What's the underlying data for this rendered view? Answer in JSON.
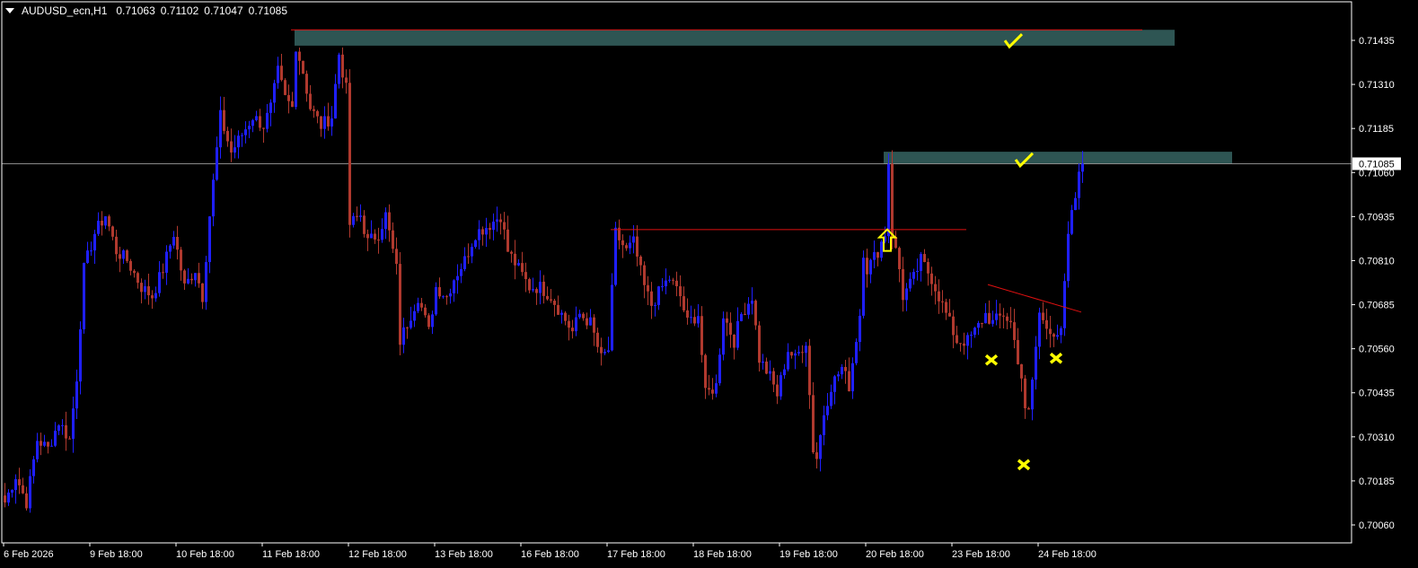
{
  "header": {
    "symbol": "AUDUSD_ecn,H1",
    "open": "0.71063",
    "high": "0.71102",
    "low": "0.71047",
    "close": "0.71085"
  },
  "colors": {
    "bull": "#1f1fff",
    "bear": "#b0392e",
    "zone": "#2e5553",
    "level_line": "#e01010",
    "marker": "#ffff00",
    "axis": "#ffffff",
    "price_line": "#8a8a8a"
  },
  "chart_data": {
    "type": "candlestick",
    "symbol": "AUDUSD_ecn",
    "timeframe": "H1",
    "ylim": [
      0.7001,
      0.7156
    ],
    "xlim": [
      0,
      375
    ],
    "y_ticks": [
      "0.71435",
      "0.71310",
      "0.71185",
      "0.71060",
      "0.70935",
      "0.70810",
      "0.70685",
      "0.70560",
      "0.70435",
      "0.70310",
      "0.70185",
      "0.70060"
    ],
    "x_ticks": [
      {
        "i": 0,
        "label": "6 Feb 2026"
      },
      {
        "i": 24,
        "label": "9 Feb 18:00"
      },
      {
        "i": 48,
        "label": "10 Feb 18:00"
      },
      {
        "i": 72,
        "label": "11 Feb 18:00"
      },
      {
        "i": 96,
        "label": "12 Feb 18:00"
      },
      {
        "i": 120,
        "label": "13 Feb 18:00"
      },
      {
        "i": 144,
        "label": "16 Feb 18:00"
      },
      {
        "i": 168,
        "label": "17 Feb 18:00"
      },
      {
        "i": 192,
        "label": "18 Feb 18:00"
      },
      {
        "i": 216,
        "label": "19 Feb 18:00"
      },
      {
        "i": 240,
        "label": "20 Feb 18:00"
      },
      {
        "i": 264,
        "label": "23 Feb 18:00"
      },
      {
        "i": 288,
        "label": "24 Feb 18:00"
      }
    ],
    "current_price": "0.71085",
    "close_waypoints": [
      [
        0,
        0.70124
      ],
      [
        3,
        0.702
      ],
      [
        6,
        0.70124
      ],
      [
        9,
        0.70302
      ],
      [
        12,
        0.70276
      ],
      [
        15,
        0.70353
      ],
      [
        18,
        0.70302
      ],
      [
        20,
        0.7048
      ],
      [
        22,
        0.70786
      ],
      [
        25,
        0.70888
      ],
      [
        28,
        0.70939
      ],
      [
        31,
        0.70837
      ],
      [
        34,
        0.70811
      ],
      [
        38,
        0.70735
      ],
      [
        41,
        0.70709
      ],
      [
        44,
        0.70786
      ],
      [
        47,
        0.70888
      ],
      [
        50,
        0.70735
      ],
      [
        53,
        0.70786
      ],
      [
        55,
        0.70709
      ],
      [
        57,
        0.70939
      ],
      [
        60,
        0.71219
      ],
      [
        63,
        0.71117
      ],
      [
        66,
        0.71168
      ],
      [
        69,
        0.71219
      ],
      [
        72,
        0.71193
      ],
      [
        74,
        0.71244
      ],
      [
        76,
        0.71346
      ],
      [
        78,
        0.7127
      ],
      [
        80,
        0.71244
      ],
      [
        81,
        0.71422
      ],
      [
        83,
        0.71346
      ],
      [
        85,
        0.71244
      ],
      [
        88,
        0.71193
      ],
      [
        91,
        0.71219
      ],
      [
        93,
        0.71397
      ],
      [
        95,
        0.71295
      ],
      [
        96,
        0.70913
      ],
      [
        99,
        0.70939
      ],
      [
        101,
        0.70862
      ],
      [
        104,
        0.70888
      ],
      [
        106,
        0.70939
      ],
      [
        109,
        0.70786
      ],
      [
        110,
        0.70582
      ],
      [
        113,
        0.70658
      ],
      [
        115,
        0.70709
      ],
      [
        118,
        0.70608
      ],
      [
        120,
        0.70735
      ],
      [
        123,
        0.70709
      ],
      [
        125,
        0.7076
      ],
      [
        128,
        0.70811
      ],
      [
        131,
        0.70888
      ],
      [
        135,
        0.70913
      ],
      [
        138,
        0.70939
      ],
      [
        140,
        0.70837
      ],
      [
        143,
        0.70786
      ],
      [
        146,
        0.70735
      ],
      [
        149,
        0.70735
      ],
      [
        152,
        0.70709
      ],
      [
        155,
        0.70658
      ],
      [
        158,
        0.70608
      ],
      [
        160,
        0.70658
      ],
      [
        163,
        0.70633
      ],
      [
        166,
        0.70531
      ],
      [
        168,
        0.70557
      ],
      [
        170,
        0.70888
      ],
      [
        173,
        0.70837
      ],
      [
        175,
        0.70862
      ],
      [
        178,
        0.70735
      ],
      [
        180,
        0.70684
      ],
      [
        183,
        0.70735
      ],
      [
        185,
        0.7076
      ],
      [
        188,
        0.70709
      ],
      [
        190,
        0.70633
      ],
      [
        193,
        0.70658
      ],
      [
        195,
        0.70429
      ],
      [
        198,
        0.70455
      ],
      [
        200,
        0.70658
      ],
      [
        203,
        0.70582
      ],
      [
        205,
        0.70658
      ],
      [
        208,
        0.70709
      ],
      [
        210,
        0.70531
      ],
      [
        213,
        0.7048
      ],
      [
        215,
        0.70429
      ],
      [
        218,
        0.70557
      ],
      [
        220,
        0.70531
      ],
      [
        223,
        0.70582
      ],
      [
        225,
        0.70276
      ],
      [
        226,
        0.70251
      ],
      [
        228,
        0.70378
      ],
      [
        230,
        0.70455
      ],
      [
        233,
        0.70506
      ],
      [
        235,
        0.70455
      ],
      [
        238,
        0.70658
      ],
      [
        239,
        0.70837
      ],
      [
        240,
        0.70786
      ],
      [
        243,
        0.70837
      ],
      [
        245,
        0.70888
      ],
      [
        246,
        0.71091
      ],
      [
        247,
        0.70888
      ],
      [
        249,
        0.70786
      ],
      [
        250,
        0.70709
      ],
      [
        253,
        0.7076
      ],
      [
        255,
        0.70811
      ],
      [
        258,
        0.7076
      ],
      [
        260,
        0.70709
      ],
      [
        263,
        0.70633
      ],
      [
        265,
        0.70582
      ],
      [
        268,
        0.70582
      ],
      [
        270,
        0.70608
      ],
      [
        273,
        0.70658
      ],
      [
        275,
        0.70633
      ],
      [
        278,
        0.70658
      ],
      [
        280,
        0.70633
      ],
      [
        283,
        0.7048
      ],
      [
        284,
        0.70378
      ],
      [
        285,
        0.70378
      ],
      [
        288,
        0.70658
      ],
      [
        290,
        0.70633
      ],
      [
        293,
        0.70582
      ],
      [
        294,
        0.70608
      ],
      [
        295,
        0.70735
      ],
      [
        296,
        0.70888
      ],
      [
        298,
        0.7099
      ],
      [
        299,
        0.71079
      ],
      [
        300,
        0.71085
      ]
    ],
    "zones": [
      {
        "from_i": 81,
        "to_i": 326,
        "top": 0.71465,
        "bottom": 0.7142
      },
      {
        "from_i": 245,
        "to_i": 342,
        "top": 0.71119,
        "bottom": 0.71084
      }
    ],
    "lines": [
      {
        "from_i": 80,
        "to_i": 317,
        "p1": 0.71465,
        "p2": 0.71465
      },
      {
        "from_i": 169,
        "to_i": 268,
        "p1": 0.70898,
        "p2": 0.70898
      },
      {
        "from_i": 274,
        "to_i": 300,
        "p1": 0.70742,
        "p2": 0.70664
      }
    ],
    "markers": [
      {
        "type": "check",
        "i": 281,
        "p": 0.71422
      },
      {
        "type": "check",
        "i": 284,
        "p": 0.71084
      },
      {
        "type": "arrow-up",
        "i": 246,
        "p": 0.70868
      },
      {
        "type": "cross",
        "i": 275,
        "p": 0.70528
      },
      {
        "type": "cross",
        "i": 293,
        "p": 0.70533
      },
      {
        "type": "cross",
        "i": 284,
        "p": 0.70231
      }
    ]
  }
}
